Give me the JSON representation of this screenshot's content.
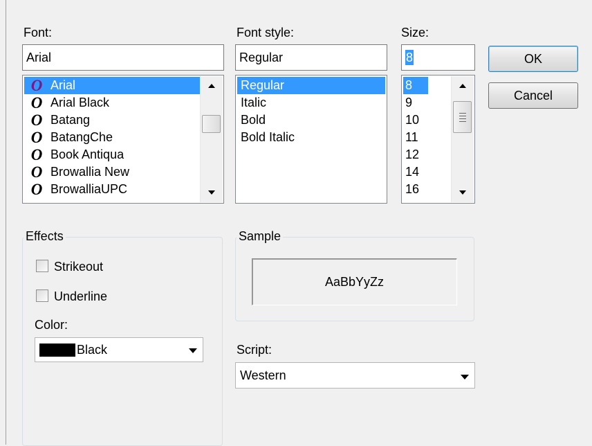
{
  "labels": {
    "font": "Font:",
    "font_style": "Font style:",
    "size": "Size:",
    "color": "Color:",
    "script": "Script:"
  },
  "font": {
    "value": "Arial",
    "glyph": "O",
    "items": [
      "Arial",
      "Arial Black",
      "Batang",
      "BatangChe",
      "Book Antiqua",
      "Browallia New",
      "BrowalliaUPC"
    ],
    "selected": "Arial"
  },
  "font_style": {
    "value": "Regular",
    "items": [
      "Regular",
      "Italic",
      "Bold",
      "Bold Italic"
    ],
    "selected": "Regular"
  },
  "size": {
    "value": "8",
    "items": [
      "8",
      "9",
      "10",
      "11",
      "12",
      "14",
      "16"
    ],
    "selected": "8"
  },
  "buttons": {
    "ok": "OK",
    "cancel": "Cancel"
  },
  "effects": {
    "title": "Effects",
    "strikeout": "Strikeout",
    "underline": "Underline",
    "strikeout_checked": false,
    "underline_checked": false
  },
  "color": {
    "value": "Black",
    "swatch": "#000000"
  },
  "sample": {
    "title": "Sample",
    "text": "AaBbYyZz"
  },
  "script": {
    "value": "Western"
  },
  "colors": {
    "selection": "#3399ff",
    "dialog_bg": "#f0f0f0"
  }
}
